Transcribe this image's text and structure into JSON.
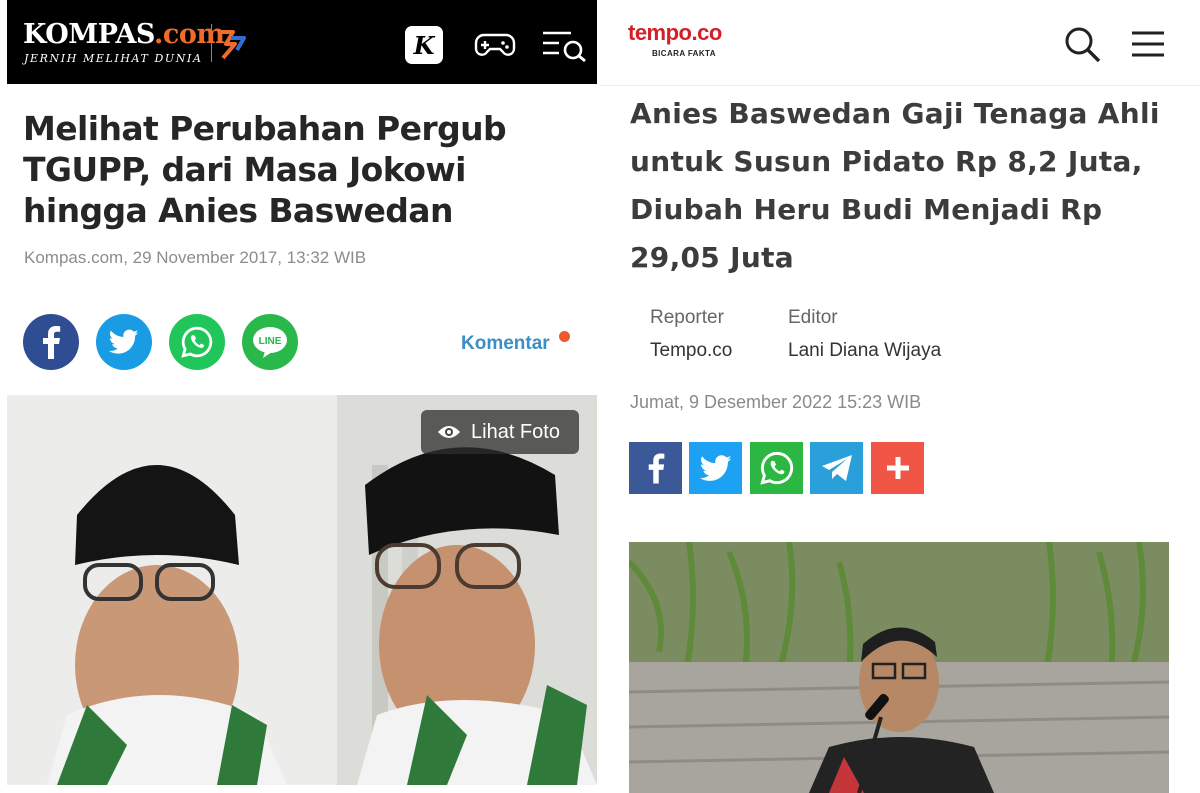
{
  "kompas": {
    "logo_text": "KOMPAS",
    "logo_suffix": ".com",
    "tagline": "JERNIH MELIHAT DUNIA",
    "header_icons": [
      "kompas-k-icon",
      "gamepad-icon",
      "menu-search-icon"
    ],
    "k_letter": "K",
    "article_title": "Melihat Perubahan Pergub TGUPP, dari Masa Jokowi hingga Anies Baswedan",
    "meta": "Kompas.com, 29 November 2017, 13:32 WIB",
    "share_icons": [
      "facebook-icon",
      "twitter-icon",
      "whatsapp-icon",
      "line-icon"
    ],
    "line_label": "LINE",
    "komentar_label": "Komentar",
    "lihat_foto_label": "Lihat Foto",
    "colors": {
      "header_bg": "#000000",
      "facebook": "#2f4d92",
      "twitter": "#1a9ce4",
      "whatsapp": "#20c65a",
      "line": "#29b84a",
      "komentar": "#3c8fc4",
      "dot": "#ef5a28"
    }
  },
  "tempo": {
    "logo_text": "tempo.co",
    "tagline": "BICARA FAKTA",
    "header_icons": [
      "search-icon",
      "hamburger-menu-icon"
    ],
    "article_title": "Anies Baswedan Gaji Tenaga Ahli untuk Susun Pidato Rp 8,2 Juta, Diubah Heru Budi Menjadi Rp 29,05 Juta",
    "reporter_label": "Reporter",
    "reporter_value": "Tempo.co",
    "editor_label": "Editor",
    "editor_value": "Lani Diana Wijaya",
    "date": "Jumat, 9 Desember 2022 15:23 WIB",
    "share_icons": [
      "facebook-icon",
      "twitter-icon",
      "whatsapp-icon",
      "telegram-icon",
      "plus-icon"
    ],
    "colors": {
      "logo": "#d32027",
      "facebook": "#3b5998",
      "twitter": "#1da1f2",
      "whatsapp": "#2bb741",
      "telegram": "#2a9fd9",
      "plus": "#f05545"
    }
  }
}
